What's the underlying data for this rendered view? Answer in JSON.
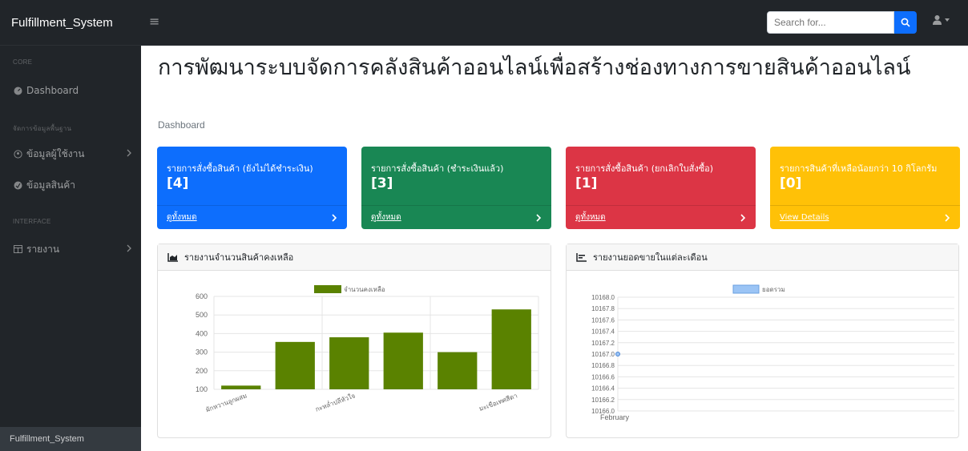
{
  "nav": {
    "brand": "Fulfillment_System",
    "search_placeholder": "Search for..."
  },
  "sidebar": {
    "heading_core": "CORE",
    "dashboard": "Dashboard",
    "heading_master": "จัดการข้อมูลพื้นฐาน",
    "users": "ข้อมูลผู้ใช้งาน",
    "products": "ข้อมูลสินค้า",
    "heading_interface": "INTERFACE",
    "reports": "รายงาน",
    "footer": "Fulfillment_System"
  },
  "page": {
    "title": "การพัฒนาระบบจัดการคลังสินค้าออนไลน์เพื่อสร้างช่องทางการขายสินค้าออนไลน์",
    "breadcrumb": "Dashboard"
  },
  "cards": [
    {
      "title": "รายการสั่งซื้อสินค้า (ยังไม่ได้ชำระเงิน)",
      "value": "[4]",
      "link": "ดูทั้งหมด",
      "color": "#0d6efd",
      "text_color": "#ffffff"
    },
    {
      "title": "รายการสั่งซื้อสินค้า (ชำระเงินแล้ว)",
      "value": "[3]",
      "link": "ดูทั้งหมด",
      "color": "#198754",
      "text_color": "#ffffff"
    },
    {
      "title": "รายการสั่งซื้อสินค้า (ยกเลิกใบสั่งซื้อ)",
      "value": "[1]",
      "link": "ดูทั้งหมด",
      "color": "#dc3545",
      "text_color": "#ffffff"
    },
    {
      "title": "รายการสินค้าที่เหลือน้อยกว่า 10 กิโลกรัม",
      "value": "[0]",
      "link": "View Details",
      "color": "#ffc107",
      "text_color": "#ffffff"
    }
  ],
  "panels": {
    "stock_title": "รายงานจำนวนสินค้าคงเหลือ",
    "sales_title": "รายงานยอดขายในแต่ละเดือน"
  },
  "chart_data": [
    {
      "type": "bar",
      "title": "",
      "series": [
        {
          "name": "จำนวนคงเหลือ",
          "color": "#5a8200"
        }
      ],
      "categories": [
        "ผักหวานลูกผสม",
        "",
        "กะหล่ำปลีหัวใจ",
        "",
        "",
        "มะเขือเทศสีดา"
      ],
      "values": [
        120,
        355,
        380,
        405,
        300,
        530
      ],
      "ylim": [
        100,
        600
      ],
      "yticks": [
        "600",
        "500",
        "400",
        "300",
        "200",
        "100"
      ],
      "grid": true,
      "legend": "top"
    },
    {
      "type": "line",
      "title": "",
      "series": [
        {
          "name": "ยอดรวม",
          "color": "#9bc4f5",
          "values": [
            10167.0
          ]
        }
      ],
      "categories": [
        "February"
      ],
      "ylim": [
        10166.0,
        10168.0
      ],
      "yticks": [
        "10168.0",
        "10167.8",
        "10167.6",
        "10167.4",
        "10167.2",
        "10167.0",
        "10166.8",
        "10166.6",
        "10166.4",
        "10166.2",
        "10166.0"
      ],
      "grid": true,
      "legend": "top"
    }
  ]
}
